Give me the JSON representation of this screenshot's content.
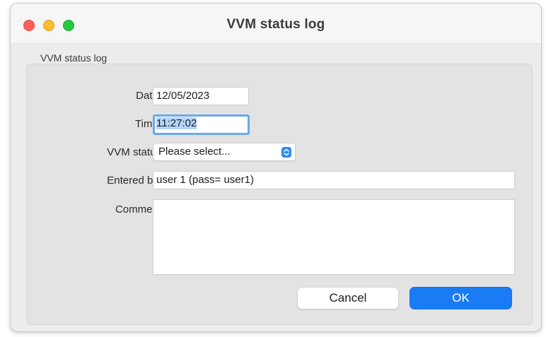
{
  "window": {
    "title": "VVM status log"
  },
  "group": {
    "label": "VVM status log"
  },
  "form": {
    "date": {
      "label": "Date:",
      "value": "12/05/2023"
    },
    "time": {
      "label": "Time:",
      "value": "11:27:02"
    },
    "vvm_status": {
      "label": "VVM status",
      "value": "Please select..."
    },
    "entered_by": {
      "label": "Entered by:",
      "value": "user 1 (pass= user1)"
    },
    "comment": {
      "label": "Comment",
      "value": ""
    }
  },
  "buttons": {
    "cancel": "Cancel",
    "ok": "OK"
  },
  "colors": {
    "accent": "#1a7cf5",
    "focus_ring": "#6aa8ec",
    "close": "#fe5f57",
    "minimize": "#febc2e",
    "zoom": "#28c840"
  },
  "icons": {
    "close": "close-window-icon",
    "minimize": "minimize-window-icon",
    "zoom": "zoom-window-icon",
    "select": "up-down-chevron-icon"
  }
}
